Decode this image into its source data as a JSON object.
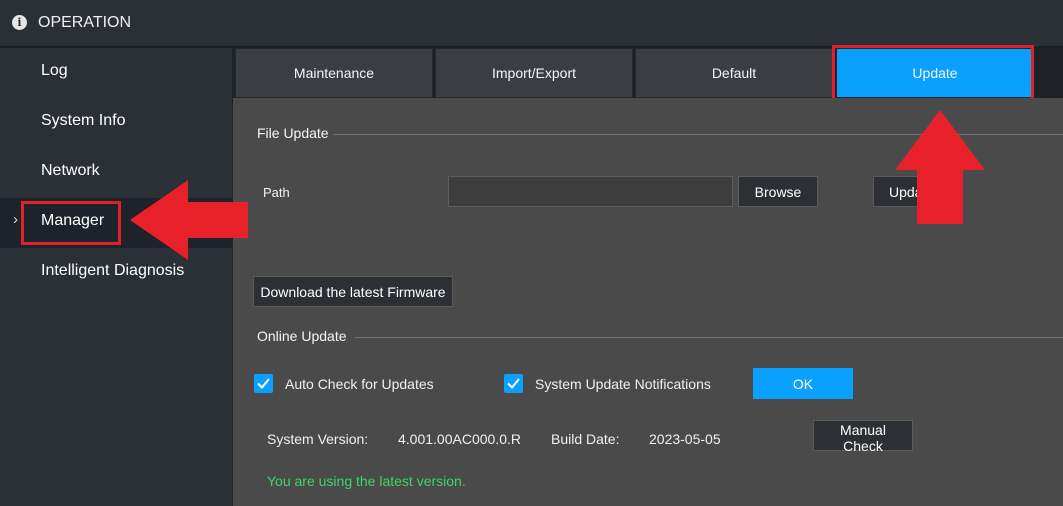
{
  "header": {
    "title": "OPERATION",
    "icon": "info-icon"
  },
  "sidebar": {
    "items": [
      {
        "label": "Log"
      },
      {
        "label": "System Info"
      },
      {
        "label": "Network"
      },
      {
        "label": "Manager"
      },
      {
        "label": "Intelligent Diagnosis"
      }
    ],
    "active_index": 3
  },
  "tabs": [
    {
      "label": "Maintenance"
    },
    {
      "label": "Import/Export"
    },
    {
      "label": "Default"
    },
    {
      "label": "Update"
    }
  ],
  "file_update": {
    "title": "File Update",
    "path_label": "Path",
    "path_value": "",
    "browse_label": "Browse",
    "update_label": "Upda",
    "download_label": "Download the latest Firmware"
  },
  "online_update": {
    "title": "Online Update",
    "auto_check_label": "Auto Check for Updates",
    "auto_check_checked": true,
    "notify_label": "System Update Notifications",
    "notify_checked": true,
    "ok_label": "OK",
    "system_version_label": "System Version:",
    "system_version_value": "4.001.00AC000.0.R",
    "build_date_label": "Build Date:",
    "build_date_value": "2023-05-05",
    "manual_check_label": "Manual Check",
    "status_text": "You are using the latest version."
  },
  "colors": {
    "accent": "#0aa0ff",
    "highlight": "#e0202a",
    "status": "#3fd46c",
    "background": "#4a4a4a",
    "sidebar": "#2b2f36"
  }
}
